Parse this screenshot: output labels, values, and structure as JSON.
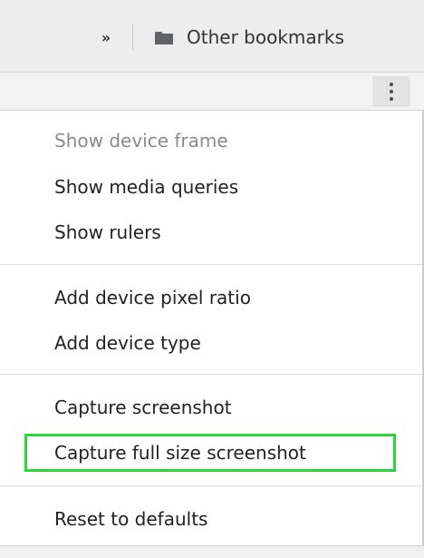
{
  "bookmarks_bar": {
    "overflow_icon": "double-chevron-right-icon",
    "folder_icon": "folder-icon",
    "other_bookmarks_label": "Other bookmarks"
  },
  "toolbar": {
    "more_icon": "vertical-dots-icon"
  },
  "menu": {
    "items": [
      {
        "label": "Show device frame",
        "disabled": true
      },
      {
        "label": "Show media queries",
        "disabled": false
      },
      {
        "label": "Show rulers",
        "disabled": false
      },
      {
        "label": "Add device pixel ratio",
        "disabled": false
      },
      {
        "label": "Add device type",
        "disabled": false
      },
      {
        "label": "Capture screenshot",
        "disabled": false
      },
      {
        "label": "Capture full size screenshot",
        "disabled": false,
        "highlighted": true
      },
      {
        "label": "Reset to defaults",
        "disabled": false
      }
    ]
  },
  "colors": {
    "highlight_border": "#2cd63a",
    "disabled_text": "#8a8a8a",
    "bar_background": "#ededed"
  }
}
